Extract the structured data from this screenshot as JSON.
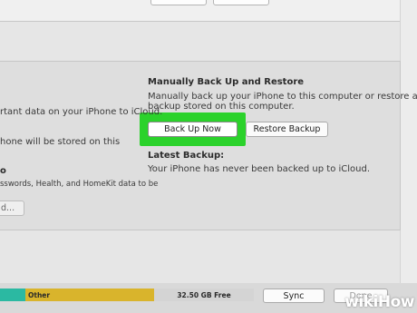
{
  "backup": {
    "manual_title": "Manually Back Up and Restore",
    "manual_desc_line1": "Manually back up your iPhone to this computer or restore a",
    "manual_desc_line2": "backup stored on this computer.",
    "back_up_now_label": "Back Up Now",
    "restore_backup_label": "Restore Backup",
    "latest_title": "Latest Backup:",
    "latest_desc": "Your iPhone has never been backed up to iCloud."
  },
  "left": {
    "line1": "rtant data on your iPhone to iCloud.",
    "line2": "hone will be stored on this",
    "line3": "o",
    "line4": "sswords, Health, and HomeKit data to be",
    "button_label": "d..."
  },
  "storage": {
    "other_label": "Other",
    "free_label": "32.50 GB Free",
    "colors": {
      "teal": "#2bb9a2",
      "other": "#d9b42c",
      "free": "#d4d4d4"
    }
  },
  "footer": {
    "sync_label": "Sync",
    "done_label": "Done"
  },
  "highlight_color": "#2bd22b",
  "watermark": {
    "wiki": "wiki",
    "how": "How"
  }
}
